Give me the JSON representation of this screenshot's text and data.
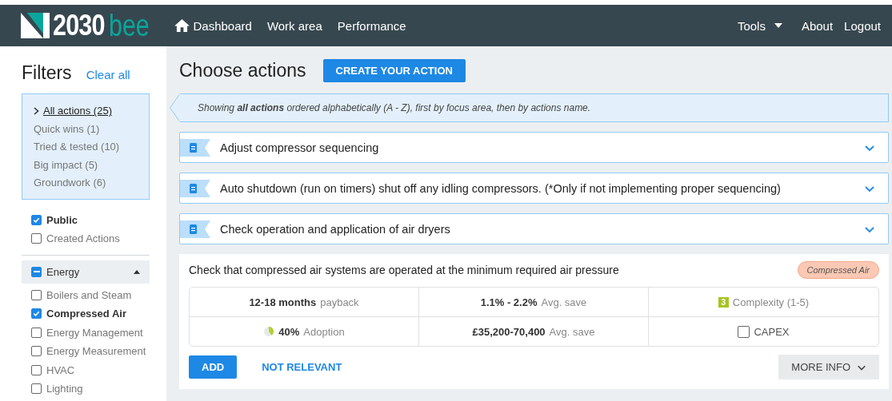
{
  "nav": {
    "logo": {
      "number": "2030",
      "word": "bee"
    },
    "links": [
      {
        "label": "Dashboard",
        "kind": "home"
      },
      {
        "label": "Work area",
        "kind": "link"
      },
      {
        "label": "Performance",
        "kind": "link"
      }
    ],
    "right": [
      {
        "label": "Tools",
        "kind": "dropdown"
      },
      {
        "label": "About",
        "kind": "link"
      },
      {
        "label": "Logout",
        "kind": "link"
      }
    ]
  },
  "filters": {
    "title": "Filters",
    "clear": "Clear all",
    "categories": [
      {
        "label": "All actions (25)",
        "selected": true
      },
      {
        "label": "Quick wins (1)",
        "selected": false
      },
      {
        "label": "Tried & tested (10)",
        "selected": false
      },
      {
        "label": "Big impact (5)",
        "selected": false
      },
      {
        "label": "Groundwork (6)",
        "selected": false
      }
    ],
    "visibility": [
      {
        "label": "Public",
        "checked": true
      },
      {
        "label": "Created Actions",
        "checked": false
      }
    ],
    "group": {
      "label": "Energy",
      "checked": true,
      "indeterminate": true,
      "expanded": true,
      "items": [
        {
          "label": "Boilers and Steam",
          "checked": false
        },
        {
          "label": "Compressed Air",
          "checked": true
        },
        {
          "label": "Energy Management",
          "checked": false
        },
        {
          "label": "Energy Measurement",
          "checked": false
        },
        {
          "label": "HVAC",
          "checked": false
        },
        {
          "label": "Lighting",
          "checked": false
        }
      ]
    }
  },
  "main": {
    "title": "Choose actions",
    "create": "CREATE YOUR ACTION",
    "notice": "Showing **all actions** ordered alphabetically (A - Z), first by focus area, then by actions name.",
    "actions": [
      {
        "title": "Adjust compressor sequencing",
        "expanded": false
      },
      {
        "title": "Auto shutdown (run on timers) shut off any idling compressors. (*Only if not implementing proper sequencing)",
        "expanded": false
      },
      {
        "title": "Check operation and application of air dryers",
        "expanded": false
      }
    ],
    "card": {
      "title": "Check that compressed air systems are operated at the minimum required air pressure",
      "tag": "Compressed Air",
      "stats": [
        {
          "kind": "text",
          "value": "12-18 months",
          "label": "payback"
        },
        {
          "kind": "text",
          "value": "1.1% - 2.2%",
          "label": "Avg. save"
        },
        {
          "kind": "badge",
          "value": "3",
          "label": "Complexity (1-5)"
        },
        {
          "kind": "pie",
          "level": 0.4,
          "value": "40%",
          "label": "Adoption"
        },
        {
          "kind": "text",
          "value": "£35,200-70,400",
          "label": "Avg. save"
        },
        {
          "kind": "checkbox",
          "checked": false,
          "label": "CAPEX"
        }
      ],
      "add": "ADD",
      "dismiss": "NOT RELEVANT",
      "more": "MORE INFO"
    }
  }
}
